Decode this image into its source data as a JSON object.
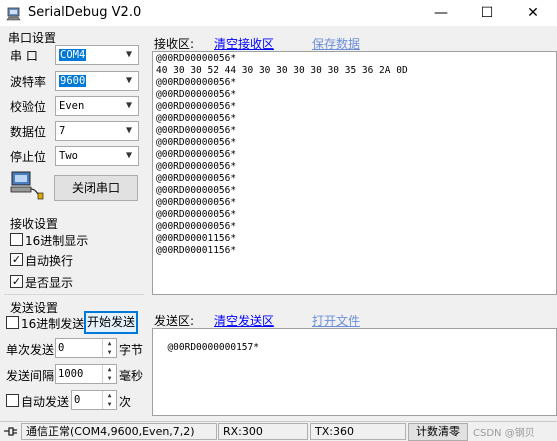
{
  "window": {
    "title": "SerialDebug V2.0",
    "controls": {
      "minimize": "—",
      "maximize": "☐",
      "close": "✕"
    }
  },
  "port_settings": {
    "group_label": "串口设置",
    "port_label": "串    口",
    "port_value": "COM4",
    "baud_label": "波特率",
    "baud_value": "9600",
    "parity_label": "校验位",
    "parity_value": "Even",
    "databits_label": "数据位",
    "databits_value": "7",
    "stopbits_label": "停止位",
    "stopbits_value": "Two",
    "close_port_button": "关闭串口"
  },
  "receive_settings": {
    "group_label": "接收设置",
    "hex_display": {
      "label": "16进制显示",
      "checked": false
    },
    "auto_wrap": {
      "label": "自动换行",
      "checked": true
    },
    "show_flag": {
      "label": "是否显示",
      "checked": true
    }
  },
  "send_settings": {
    "group_label": "发送设置",
    "hex_send": {
      "label": "16进制发送",
      "checked": false
    },
    "start_send_button": "开始发送",
    "single_send_label": "单次发送",
    "single_send_value": "0",
    "single_send_unit": "字节",
    "interval_label": "发送间隔",
    "interval_value": "1000",
    "interval_unit": "毫秒",
    "auto_send": {
      "label": "自动发送",
      "checked": false
    },
    "auto_send_value": "0",
    "auto_send_unit": "次"
  },
  "receive_area": {
    "label": "接收区:",
    "clear_link": "清空接收区",
    "save_link": "保存数据",
    "lines": [
      "@00RD00000056*",
      "40 30 30 52 44 30 30 30 30 30 30 35 36 2A 0D",
      "@00RD00000056*",
      "@00RD00000056*",
      "@00RD00000056*",
      "@00RD00000056*",
      "@00RD00000056*",
      "@00RD00000056*",
      "@00RD00000056*",
      "@00RD00000056*",
      "@00RD00000056*",
      "@00RD00000056*",
      "@00RD00000056*",
      "@00RD00000056*",
      "@00RD00000056*",
      "@00RD00001156*",
      "@00RD00001156*"
    ]
  },
  "send_area": {
    "label": "发送区:",
    "clear_link": "清空发送区",
    "open_link": "打开文件",
    "content": "@00RD0000000157*"
  },
  "statusbar": {
    "status": "通信正常(COM4,9600,Even,7,2)",
    "rx": "RX:300",
    "tx": "TX:360",
    "clear_count_button": "计数清零",
    "watermark": "CSDN @钢贝"
  },
  "colors": {
    "accent": "#0078d7",
    "link": "#0000ff",
    "link_dim": "#6d8fd8"
  }
}
